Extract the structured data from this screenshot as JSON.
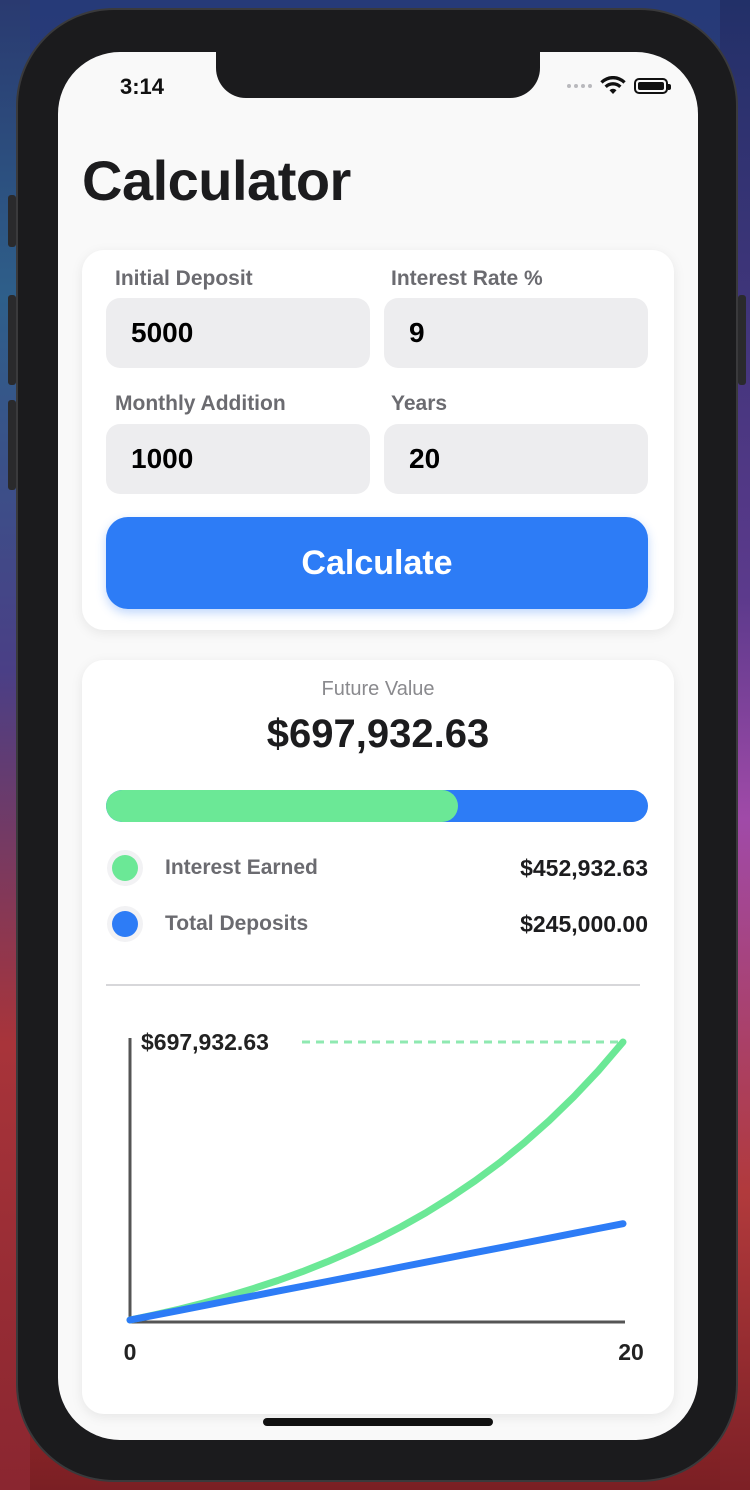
{
  "status_bar": {
    "time": "3:14"
  },
  "page": {
    "title": "Calculator"
  },
  "form": {
    "fields": [
      {
        "label": "Initial Deposit",
        "value": "5000"
      },
      {
        "label": "Interest Rate %",
        "value": "9"
      },
      {
        "label": "Monthly Addition",
        "value": "1000"
      },
      {
        "label": "Years",
        "value": "20"
      }
    ],
    "calculate_label": "Calculate"
  },
  "results": {
    "future_value_label": "Future Value",
    "future_value": "$697,932.63",
    "interest_fraction": 0.649,
    "legend": [
      {
        "label": "Interest Earned",
        "value": "$452,932.63",
        "color": "#6be896"
      },
      {
        "label": "Total Deposits",
        "value": "$245,000.00",
        "color": "#2d7cf6"
      }
    ]
  },
  "colors": {
    "accent": "#2d7cf6",
    "interest": "#6be896"
  },
  "chart_data": {
    "type": "line",
    "x_tick_labels": [
      "0",
      "20"
    ],
    "max_label": "$697,932.63",
    "xlim": [
      0,
      20
    ],
    "ylim": [
      0,
      697932.63
    ],
    "series": [
      {
        "name": "Interest Earned",
        "color": "#6be896",
        "x": [
          0,
          1,
          2,
          3,
          4,
          5,
          6,
          7,
          8,
          9,
          10,
          11,
          12,
          13,
          14,
          15,
          16,
          17,
          18,
          19,
          20
        ],
        "values": [
          5000,
          17984,
          32173,
          47692,
          64667,
          83233,
          103540,
          125751,
          150045,
          176617,
          205681,
          237470,
          272240,
          310271,
          351868,
          397365,
          447129,
          501560,
          561095,
          626213,
          697933
        ]
      },
      {
        "name": "Total Deposits",
        "color": "#2d7cf6",
        "x": [
          0,
          1,
          2,
          3,
          4,
          5,
          6,
          7,
          8,
          9,
          10,
          11,
          12,
          13,
          14,
          15,
          16,
          17,
          18,
          19,
          20
        ],
        "values": [
          5000,
          17000,
          29000,
          41000,
          53000,
          65000,
          77000,
          89000,
          101000,
          113000,
          125000,
          137000,
          149000,
          161000,
          173000,
          185000,
          197000,
          209000,
          221000,
          233000,
          245000
        ]
      }
    ]
  }
}
